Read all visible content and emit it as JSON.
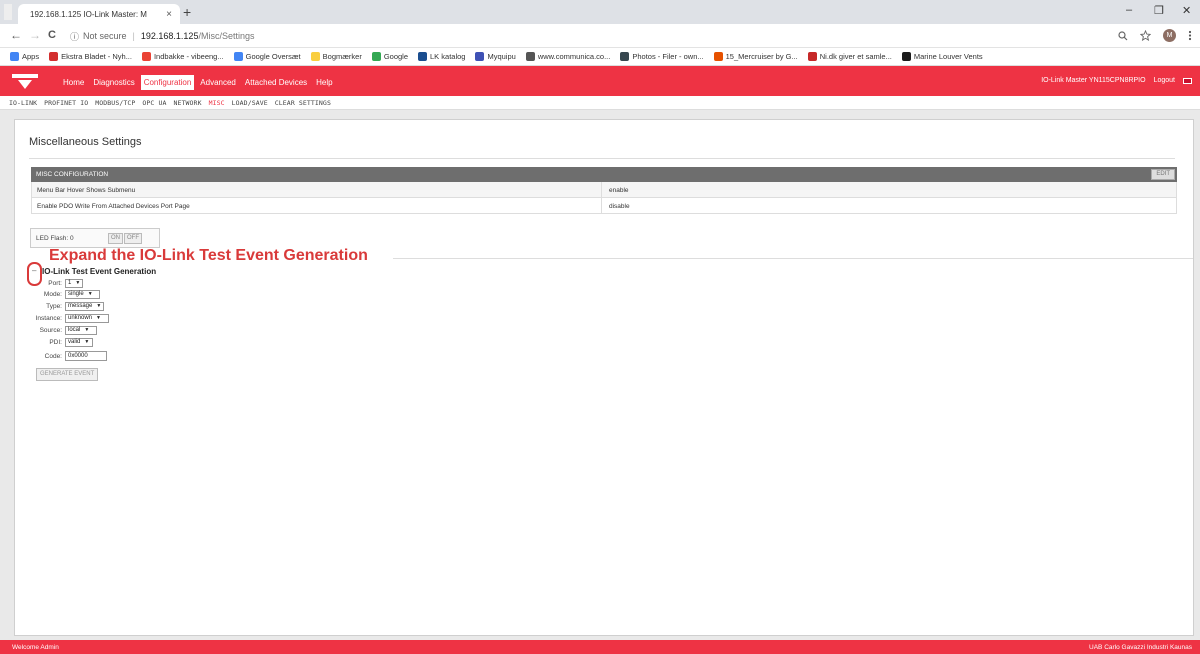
{
  "browser": {
    "tab_title": "192.168.1.125 IO-Link Master: M",
    "tab_close": "×",
    "new_tab": "+",
    "win_min": "–",
    "win_max": "❐",
    "win_close": "✕",
    "back": "←",
    "forward": "→",
    "reload": "C",
    "info_icon": "ⓘ",
    "not_secure": "Not secure",
    "url_host": "192.168.1.125",
    "url_path": "/Misc/Settings",
    "avatar_letter": "M",
    "bookmarks": [
      {
        "label": "Apps",
        "color": "#4285f4"
      },
      {
        "label": "Ekstra Bladet - Nyh...",
        "color": "#d32f2f"
      },
      {
        "label": "Indbakke - vibeeng...",
        "color": "#ea4335"
      },
      {
        "label": "Google Oversæt",
        "color": "#4285f4"
      },
      {
        "label": "Bogmærker",
        "color": "#f9ce3f"
      },
      {
        "label": "Google",
        "color": "#34a853"
      },
      {
        "label": "LK katalog",
        "color": "#1a4d8f"
      },
      {
        "label": "Myquipu",
        "color": "#3f51b5"
      },
      {
        "label": "www.communica.co...",
        "color": "#555555"
      },
      {
        "label": "Photos - Filer - own...",
        "color": "#37474f"
      },
      {
        "label": "15_Mercruiser by G...",
        "color": "#e65100"
      },
      {
        "label": "Ni.dk giver et samle...",
        "color": "#c62828"
      },
      {
        "label": "Marine Louver Vents",
        "color": "#1b1b1b"
      }
    ]
  },
  "header": {
    "menu": [
      {
        "label": "Home",
        "active": false
      },
      {
        "label": "Diagnostics",
        "active": false
      },
      {
        "label": "Configuration",
        "active": true
      },
      {
        "label": "Advanced",
        "active": false
      },
      {
        "label": "Attached Devices",
        "active": false
      },
      {
        "label": "Help",
        "active": false
      }
    ],
    "device_name": "IO-Link Master YN115CPN8RPIO",
    "logout": "Logout"
  },
  "submenu": [
    {
      "label": "IO-LINK",
      "active": false
    },
    {
      "label": "PROFINET IO",
      "active": false
    },
    {
      "label": "MODBUS/TCP",
      "active": false
    },
    {
      "label": "OPC UA",
      "active": false
    },
    {
      "label": "NETWORK",
      "active": false
    },
    {
      "label": "MISC",
      "active": true
    },
    {
      "label": "LOAD/SAVE",
      "active": false
    },
    {
      "label": "CLEAR SETTINGS",
      "active": false
    }
  ],
  "page": {
    "title": "Miscellaneous Settings",
    "misc_header": "MISC CONFIGURATION",
    "edit": "EDIT",
    "rows": [
      {
        "key": "Menu Bar Hover Shows Submenu",
        "value": "enable"
      },
      {
        "key": "Enable PDO Write From Attached Devices Port Page",
        "value": "disable"
      }
    ],
    "led_label": "LED Flash: 0",
    "led_on": "ON",
    "led_off": "OFF",
    "annotation": "Expand the IO-Link Test Event Generation",
    "expand_symbol": "–",
    "event_title": "IO-Link Test Event Generation",
    "fields": [
      {
        "label": "Port:",
        "value": "1",
        "type": "select"
      },
      {
        "label": "Mode:",
        "value": "single",
        "type": "select"
      },
      {
        "label": "Type:",
        "value": "message",
        "type": "select"
      },
      {
        "label": "Instance:",
        "value": "unknown",
        "type": "select"
      },
      {
        "label": "Source:",
        "value": "local",
        "type": "select"
      },
      {
        "label": "PDI:",
        "value": "valid",
        "type": "select"
      },
      {
        "label": "Code:",
        "value": "0x0000",
        "type": "input"
      }
    ],
    "generate": "GENERATE EVENT"
  },
  "footer": {
    "left": "Welcome Admin",
    "right": "UAB Carlo Gavazzi Industri Kaunas"
  }
}
